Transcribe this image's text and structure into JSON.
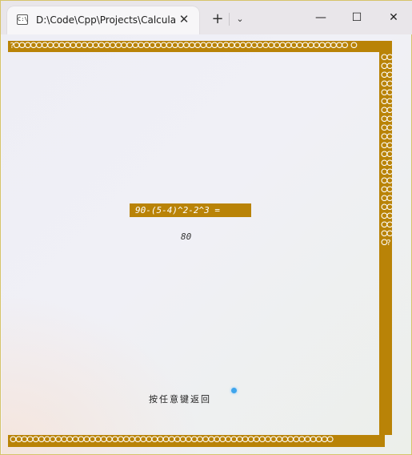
{
  "window": {
    "tab_icon": "C:\\",
    "tab_title": "D:\\Code\\Cpp\\Projects\\Calcula",
    "close_tab": "✕",
    "new_tab": "+",
    "tab_menu": "⌄",
    "minimize": "—",
    "maximize": "☐",
    "close": "✕"
  },
  "console": {
    "border_top": "?ⵔⵔⵔⵔⵔⵔⵔⵔⵔⵔⵔⵔⵔⵔⵔⵔⵔⵔⵔⵔⵔⵔⵔⵔⵔⵔⵔⵔⵔⵔⵔⵔⵔⵔⵔⵔⵔⵔⵔⵔⵔⵔⵔⵔⵔⵔⵔⵔⵔⵔⵔⵔⵔⵔⵔⵔⵔⵔⵔ ⵔ",
    "border_right": "ⵔⵔⵔⵔⵔⵔⵔⵔⵔⵔⵔⵔⵔⵔⵔⵔⵔⵔⵔⵔⵔⵔⵔⵔⵔⵔⵔⵔⵔⵔⵔⵔⵔⵔⵔⵔⵔⵔⵔⵔⵔⵔⵔ?",
    "border_bottom": "ⵔⵔⵔⵔⵔⵔⵔⵔⵔⵔⵔⵔⵔⵔⵔⵔⵔⵔⵔⵔⵔⵔⵔⵔⵔⵔⵔⵔⵔⵔⵔⵔⵔⵔⵔⵔⵔⵔⵔⵔⵔⵔⵔⵔⵔⵔⵔⵔⵔⵔⵔⵔⵔⵔⵔⵔⵔ",
    "expression": "90-(5-4)^2-2^3 =",
    "result": "80",
    "hint": "按任意键返回"
  },
  "colors": {
    "accent": "#b98307",
    "cursor": "#3fa5ec"
  }
}
